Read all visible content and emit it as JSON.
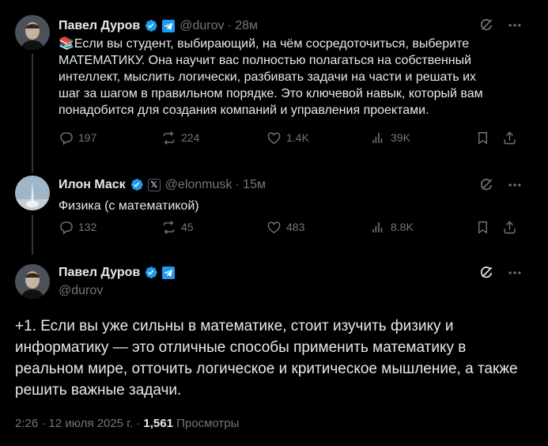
{
  "tweets": [
    {
      "name": "Павел Дуров",
      "handle": "@durov",
      "time": "· 28м",
      "text": "📚Если вы студент, выбирающий, на чём сосредоточиться, выберите МАТЕМАТИКУ. Она научит вас полностью полагаться на собственный интеллект, мыслить логически, разбивать задачи на части и решать их шаг за шагом в правильном порядке. Это ключевой навык, который вам понадобится для создания компаний и управления проектами.",
      "replies": "197",
      "reposts": "224",
      "likes": "1.4K",
      "views": "39K"
    },
    {
      "name": "Илон Маск",
      "handle": "@elonmusk",
      "time": "· 15м",
      "text": "Физика (с математикой)",
      "replies": "132",
      "reposts": "45",
      "likes": "483",
      "views": "8.8K"
    }
  ],
  "main_tweet": {
    "name": "Павел Дуров",
    "handle": "@durov",
    "text": "+1. Если вы уже сильны в математике, стоит изучить физику и информатику — это отличные способы применить математику в реальном мире, отточить логическое и критическое мышление, а также решить важные задачи.",
    "time_date": "2:26 · 12 июля 2025 г. ·",
    "views_count": "1,561",
    "views_label": "Просмотры"
  },
  "colors": {
    "background": "#000000",
    "text": "#e7e9ea",
    "muted": "#71767b",
    "verified": "#1d9bf0"
  },
  "icons": [
    "verified-badge-icon",
    "telegram-icon",
    "x-logo-icon",
    "grok-icon",
    "more-icon",
    "reply-icon",
    "repost-icon",
    "like-icon",
    "views-icon",
    "bookmark-icon",
    "share-icon"
  ]
}
